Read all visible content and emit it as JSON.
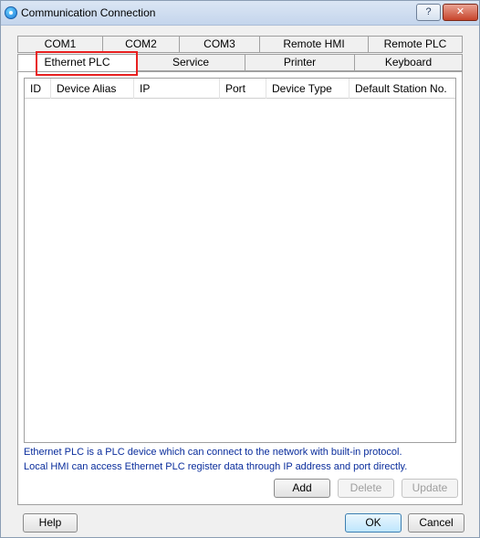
{
  "window": {
    "title": "Communication Connection",
    "help_glyph": "?",
    "close_glyph": "✕",
    "accent_color": "#1a78d8",
    "highlight_color": "#e82020"
  },
  "tabs_row1": [
    {
      "label": "COM1"
    },
    {
      "label": "COM2"
    },
    {
      "label": "COM3"
    },
    {
      "label": "Remote HMI"
    },
    {
      "label": "Remote PLC"
    }
  ],
  "tabs_row2": [
    {
      "label": "Ethernet PLC",
      "active": true
    },
    {
      "label": "Service"
    },
    {
      "label": "Printer"
    },
    {
      "label": "Keyboard"
    }
  ],
  "table": {
    "columns": [
      "ID",
      "Device Alias",
      "IP",
      "Port",
      "Device Type",
      "Default Station No."
    ],
    "rows": []
  },
  "description": {
    "line1": "Ethernet PLC is a PLC device which can connect to the network with built-in protocol.",
    "line2": "Local HMI can access Ethernet PLC register data through IP address and port directly."
  },
  "actions": {
    "add": "Add",
    "delete": "Delete",
    "update": "Update"
  },
  "footer": {
    "help": "Help",
    "ok": "OK",
    "cancel": "Cancel"
  }
}
